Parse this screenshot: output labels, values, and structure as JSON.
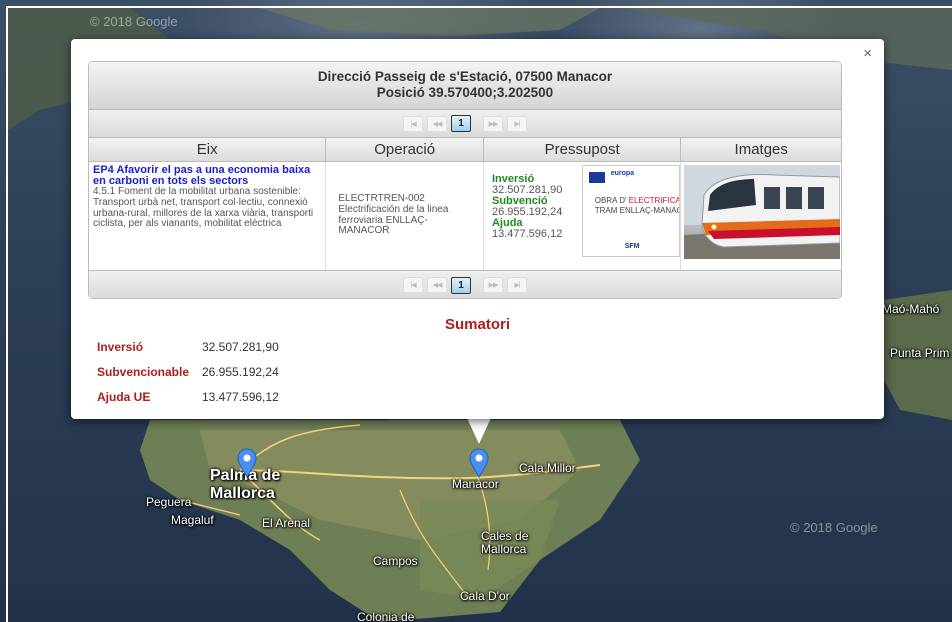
{
  "map": {
    "watermark_top": "© 2018 Google",
    "watermark_bottom": "© 2018 Google",
    "places": {
      "palma": "Palma de Mallorca",
      "peguera": "Peguera",
      "magaluf": "Magaluf",
      "el_arenal": "El Arenal",
      "manacor": "Manacor",
      "cala_millor": "Cala Millor",
      "cales_de_mallorca": "Cales de Mallorca",
      "campos": "Campos",
      "cala_dor": "Cala D'or",
      "colonia_de": "Colonia de",
      "mao": "Maó-Mahó",
      "punta_prima": "Punta Prim",
      "manacor_road": "Manacor"
    }
  },
  "popup": {
    "close_symbol": "×",
    "address": "Direcció Passeig de s'Estació, 07500 Manacor",
    "position": "Posició 39.570400;3.202500",
    "pager": {
      "first": "|◀",
      "prev": "◀◀",
      "current": "1",
      "next": "▶▶",
      "last": "▶|"
    },
    "columns": [
      "Eix",
      "Operació",
      "Pressupost",
      "Imatges"
    ],
    "row": {
      "eix_title": "EP4 Afavorir el pas a una economia baixa en carboni en tots els sectors",
      "eix_text": "4.5.1 Foment de la mobilitat urbana sostenible: Transport urbà net, transport col·lectiu, connexió urbana-rural, millores de la xarxa viària, transporti ciclista, per als vianants, mobilitat elèctrica",
      "operacio_code": "ELECTRTREN-002",
      "operacio_text": "Electrificación de la linea ferroviaria ENLLAÇ-MANACOR",
      "inversio_label": "Inversió",
      "inversio_value": "32.507.281,90",
      "subvencio_label": "Subvenció",
      "subvencio_value": "26.955.192,24",
      "ajuda_label": "Ajuda",
      "ajuda_value": "13.477.596,12",
      "poster": {
        "eu": "europa",
        "line1_prefix": "OBRA D' ",
        "line1_highlight": "ELECTRIFICACIÓ",
        "line2": "TRAM ENLLAÇ-MANACOR",
        "footer": "SFM"
      }
    },
    "sumatori": {
      "title": "Sumatori",
      "rows": [
        {
          "label": "Inversió",
          "value": "32.507.281,90"
        },
        {
          "label": "Subvencionable",
          "value": "26.955.192,24"
        },
        {
          "label": "Ajuda UE",
          "value": "13.477.596,12"
        }
      ]
    }
  },
  "colors": {
    "title_red": "#b01c1c",
    "eix_blue": "#1b1bd4",
    "money_green": "#1f8a1f",
    "pin_blue": "#4a8ff0"
  }
}
